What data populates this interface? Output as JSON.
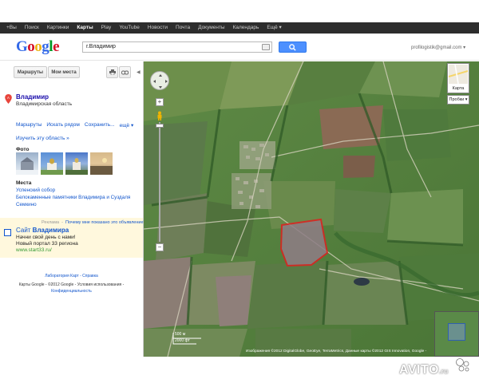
{
  "topbar": {
    "items": [
      "+Вы",
      "Поиск",
      "Картинки",
      "Карты",
      "Play",
      "YouTube",
      "Новости",
      "Почта",
      "Документы",
      "Календарь",
      "Ещё ▾"
    ],
    "active_index": 3
  },
  "header": {
    "logo_text": "Google",
    "search_value": "г.Владимир",
    "user_email": "profilogistik@gmail.com ▾"
  },
  "leftpanel": {
    "buttons": {
      "routes": "Маршруты",
      "myplaces": "Мои места"
    },
    "place": {
      "title": "Владимир",
      "region": "Владимирская область",
      "actions": [
        "Маршруты",
        "Искать рядом",
        "Сохранить...",
        "ещё ▾"
      ],
      "explore": "Изучить эту область »",
      "photos_title": "Фото",
      "places_title": "Места",
      "places": [
        "Успенский собор",
        "Белокаменные памятники Владимира и Суздаля",
        "Семкино"
      ]
    },
    "ad": {
      "label": "Реклама",
      "label_link": "Почему мне показано это объявление?",
      "title_prefix": "Сайт ",
      "title_bold": "Владимира",
      "line1": "Начни свой день с нами!",
      "line2": "Новый портал 33 региона",
      "url": "www.start33.ru/"
    },
    "footer": {
      "line1": "Лаборатория Карт - Справка",
      "line2": "Карты Google - ©2012 Google - Условия использования -",
      "line3": "Конфиденциальность"
    }
  },
  "map": {
    "type_label": "Карта",
    "traffic_label": "Пробки ▾",
    "scale_top": "500 м",
    "scale_bottom": "2000 фт",
    "copyright": "Изображения ©2012 DigitalGlobe, GeoEye, TerraMetrics, Данные карты ©2012 GIS Innovation, Google -",
    "zoom_in": "+",
    "zoom_out": "−"
  },
  "watermark": {
    "text": "AVITO",
    "suffix": ".ru"
  },
  "colors": {
    "topbar_bg": "#2d2d2d",
    "link_blue": "#1155cc",
    "search_button": "#4d90fe",
    "highlight_polygon": "#e02020",
    "ad_bg": "#fff8dd"
  }
}
